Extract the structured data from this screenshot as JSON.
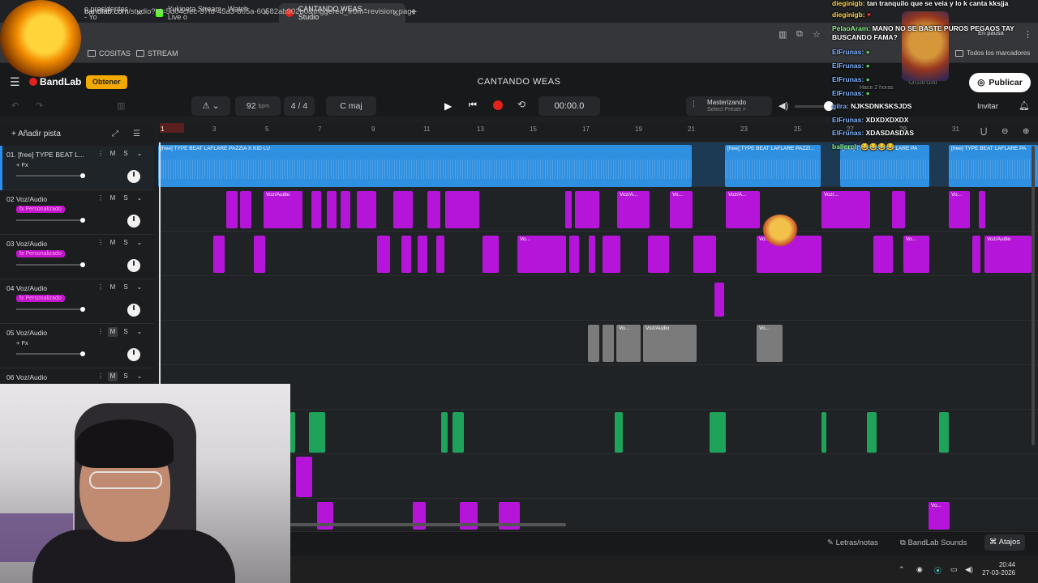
{
  "browser": {
    "tabs": [
      {
        "label": "o presidentes - Yo",
        "color": "#ff0000"
      },
      {
        "label": "Yukineta Stream - Watch Live o",
        "color": "#53fc18"
      },
      {
        "label": "CANTANDO WEAS - Studio",
        "color": "#e2231a"
      }
    ],
    "new_tab": "+",
    "url_host": "bandlab.com",
    "url_path": "/studio?id=5d04cfec-37fd-45a3-805a-60582ab902b0&triggered_from=revision_page",
    "bookmarks": [
      "COSITAS",
      "STREAM"
    ],
    "bookmarks_right": "Todos los marcadores",
    "paused": "En pausa"
  },
  "bandlab": {
    "logo": "BandLab",
    "obtener": "Obtener",
    "project_title": "CANTANDO WEAS",
    "guardar": "Guardar",
    "publicar": "Publicar",
    "invitar": "Invitar",
    "tempo": "92",
    "tempo_unit": "bpm",
    "time_sig": "4 / 4",
    "key": "C maj",
    "time": "00:00.0",
    "master_title": "Masterizando",
    "master_sub": "Select Preset >",
    "add_track": "+ Añadir pista"
  },
  "ruler": [
    "1",
    "3",
    "5",
    "7",
    "9",
    "11",
    "13",
    "15",
    "17",
    "19",
    "21",
    "23",
    "25",
    "27",
    "29",
    "31"
  ],
  "tracks": [
    {
      "name": "01. [free] TYPE BEAT L...",
      "tag": "+ Fx",
      "tag_type": "fx"
    },
    {
      "name": "02  Voz/Audio",
      "tag": "fx Personalizado",
      "tag_type": "custom"
    },
    {
      "name": "03  Voz/Audio",
      "tag": "fx Personalizado",
      "tag_type": "custom"
    },
    {
      "name": "04  Voz/Audio",
      "tag": "fx Personalizado",
      "tag_type": "custom"
    },
    {
      "name": "05  Voz/Audio",
      "tag": "+ Fx",
      "tag_type": "fx"
    },
    {
      "name": "06  Voz/Audio",
      "tag": "",
      "tag_type": "none"
    }
  ],
  "clip_labels": {
    "beat": "[free] TYPE BEAT LAFLARE PAZZIA X KID LU",
    "beat_short": "[free] TYPE BEAT LAFLARE PAZZI...",
    "beat_short2": "[free] TYPE BEAT LAFLARE PA",
    "voz": "Voz/Audio",
    "voz_a": "Voz/A...",
    "vo": "Vo...",
    "voz_short": "Voz/..."
  },
  "bottom": {
    "letras": "Letras/notas",
    "sounds": "BandLab Sounds",
    "atajos": "Atajos"
  },
  "clock": {
    "time": "20:44",
    "date": "27-03-2026"
  },
  "chat": [
    {
      "user": "dieginigb:",
      "msg": "tan tranquilo que se veia y lo k canta kksjja",
      "color": "y"
    },
    {
      "user": "dieginigb:",
      "msg": "",
      "color": "y"
    },
    {
      "user": "PelaoAram:",
      "msg": "MANO NO SE BASTE PUROS PEGAOS TAY BUSCANDO FAMA?",
      "color": "g"
    },
    {
      "user": "ElFrunas:",
      "msg": "",
      "color": "b"
    },
    {
      "user": "ElFrunas:",
      "msg": "",
      "color": "b"
    },
    {
      "user": "ElFrunas:",
      "msg": "",
      "color": "b"
    },
    {
      "user": "ElFrunas:",
      "msg": "",
      "color": "b"
    },
    {
      "user": "gilra:",
      "msg": "NJKSDNKSKSJDS",
      "color": "b"
    },
    {
      "user": "ElFrunas:",
      "msg": "XDXDXDXDX",
      "color": "b"
    },
    {
      "user": "ElFrunas:",
      "msg": "XDASDASDAS",
      "color": "b"
    },
    {
      "user": "ballercl:",
      "msg": "😂😂😂😂",
      "color": "g"
    }
  ],
  "chat_extra": {
    "saved": "Hace 2 horas"
  }
}
